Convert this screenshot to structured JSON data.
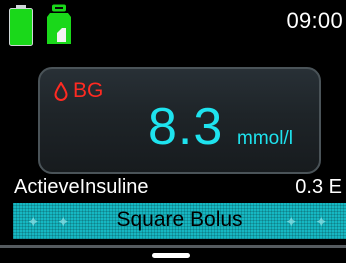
{
  "status": {
    "clock": "09:00",
    "battery_icon": "battery-icon",
    "reservoir_icon": "reservoir-icon",
    "battery_color": "#1ad81a",
    "reservoir_color": "#1ad81a"
  },
  "bg": {
    "label": "BG",
    "value": "8.3",
    "unit": "mmol/l",
    "icon": "blood-drop-icon",
    "label_color": "#ff2a22",
    "value_color": "#1ee3ee"
  },
  "insulin": {
    "label": "ActieveInsuline",
    "value": "0.3 E"
  },
  "bolus": {
    "label": "Square Bolus",
    "color": "#16b7c2"
  }
}
